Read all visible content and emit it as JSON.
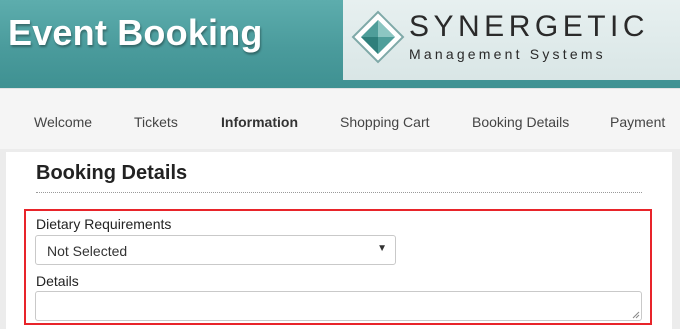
{
  "header": {
    "title": "Event Booking",
    "logo": {
      "name": "SYNERGETIC",
      "subtitle": "Management Systems",
      "icon": "synergetic-diamond-logo"
    }
  },
  "nav": {
    "items": [
      {
        "label": "Welcome",
        "active": false
      },
      {
        "label": "Tickets",
        "active": false
      },
      {
        "label": "Information",
        "active": true
      },
      {
        "label": "Shopping Cart",
        "active": false
      },
      {
        "label": "Booking Details",
        "active": false
      },
      {
        "label": "Payment",
        "active": false
      }
    ]
  },
  "main": {
    "title": "Booking Details",
    "dietary": {
      "label": "Dietary Requirements",
      "selected": "Not Selected",
      "arrow_icon": "caret-down-icon"
    },
    "details": {
      "label": "Details",
      "value": ""
    }
  },
  "colors": {
    "banner": "#4a9b9c",
    "highlight": "#e8242a",
    "logo_teal": "#3d8f8c"
  }
}
